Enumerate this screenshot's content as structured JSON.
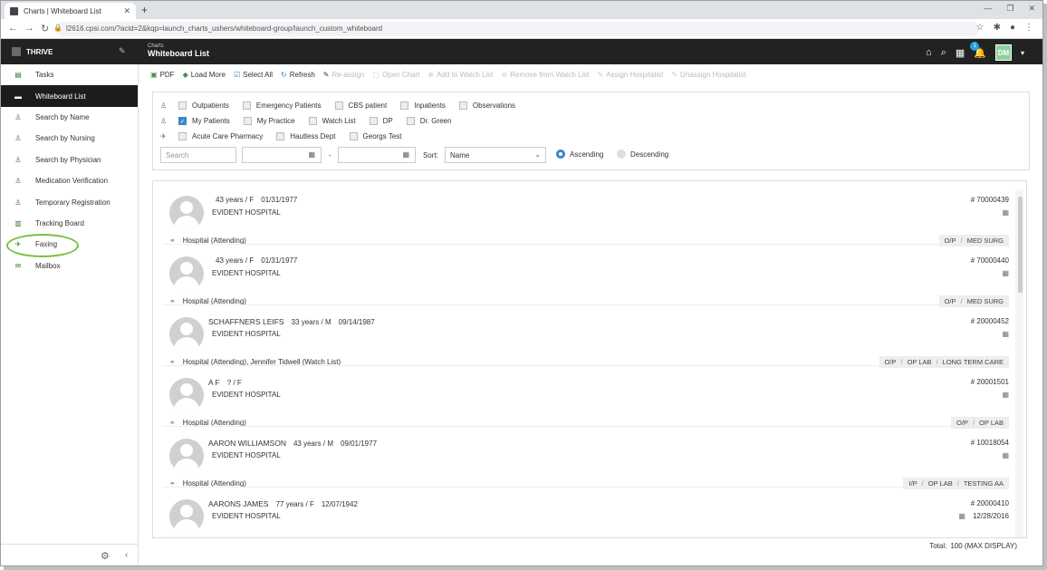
{
  "browser": {
    "tab_title": "Charts | Whiteboard List",
    "url": "l2616.cpsi.com/?acid=2&kqp=launch_charts_ushers/whiteboard-group/launch_custom_whiteboard"
  },
  "header": {
    "brand": "THRIVE",
    "section": "Charts",
    "title": "Whiteboard List",
    "notification_count": "1",
    "user_initials": "DM"
  },
  "sidebar": {
    "items": [
      {
        "label": "Tasks"
      },
      {
        "label": "Whiteboard List"
      },
      {
        "label": "Search by Name"
      },
      {
        "label": "Search by Nursing"
      },
      {
        "label": "Search by Physician"
      },
      {
        "label": "Medication Verification"
      },
      {
        "label": "Temporary Registration"
      },
      {
        "label": "Tracking Board"
      },
      {
        "label": "Faxing"
      },
      {
        "label": "Mailbox"
      }
    ]
  },
  "toolbar": {
    "pdf": "PDF",
    "load_more": "Load More",
    "select_all": "Select All",
    "refresh": "Refresh",
    "reassign": "Re-assign",
    "open_chart": "Open Chart",
    "add_watch": "Add to Watch List",
    "remove_watch": "Remove from Watch List",
    "assign_hosp": "Assign Hospitalist",
    "unassign_hosp": "Unassign Hospitalist"
  },
  "filters": {
    "row1": [
      "Outpatients",
      "Emergency Patients",
      "CBS patient",
      "Inpatients",
      "Observations"
    ],
    "row2": [
      "My Patients",
      "My Practice",
      "Watch List",
      "DP",
      "Dr. Green"
    ],
    "row3": [
      "Acute Care Pharmacy",
      "Hautless Dept",
      "Georgs Test"
    ],
    "search_placeholder": "Search",
    "dash": "-",
    "sort_label": "Sort:",
    "sort_value": "Name",
    "ascending": "Ascending",
    "descending": "Descending"
  },
  "patients": [
    {
      "name": "",
      "age": "43 years / F",
      "dob": "01/31/1977",
      "hospital": "EVIDENT HOSPITAL",
      "id": "# 70000439",
      "date": "",
      "assign": "Hospital (Attending)",
      "tags": [
        "O/P",
        "MED SURG"
      ]
    },
    {
      "name": "",
      "age": "43 years / F",
      "dob": "01/31/1977",
      "hospital": "EVIDENT HOSPITAL",
      "id": "# 70000440",
      "date": "",
      "assign": "Hospital (Attending)",
      "tags": [
        "O/P",
        "MED SURG"
      ]
    },
    {
      "name": "SCHAFFNERS LEIFS",
      "age": "33 years / M",
      "dob": "09/14/1987",
      "hospital": "EVIDENT HOSPITAL",
      "id": "# 20000452",
      "date": "",
      "assign": "Hospital (Attending), Jennifer Tidwell (Watch List)",
      "tags": [
        "O/P",
        "OP LAB",
        "LONG TERM CARE"
      ]
    },
    {
      "name": "A F",
      "age": "? / F",
      "dob": "",
      "hospital": "EVIDENT HOSPITAL",
      "id": "# 20001501",
      "date": "",
      "assign": "Hospital (Attending)",
      "tags": [
        "O/P",
        "OP LAB"
      ]
    },
    {
      "name": "AARON WILLIAMSON",
      "age": "43 years / M",
      "dob": "09/01/1977",
      "hospital": "EVIDENT HOSPITAL",
      "id": "# 10018054",
      "date": "",
      "assign": "Hospital (Attending)",
      "tags": [
        "I/P",
        "OP LAB",
        "TESTING AA"
      ]
    },
    {
      "name": "AARONS JAMES",
      "age": "77 years / F",
      "dob": "12/07/1942",
      "hospital": "EVIDENT HOSPITAL",
      "id": "# 20000410",
      "date": "12/28/2016",
      "assign": "",
      "tags": []
    }
  ],
  "footer": {
    "total_label": "Total:",
    "total_value": "100 (MAX DISPLAY)"
  }
}
